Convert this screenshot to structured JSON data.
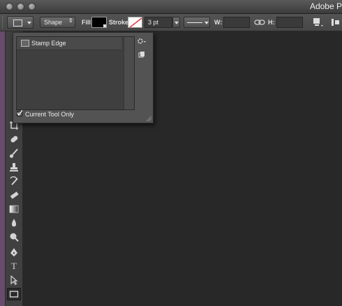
{
  "window": {
    "title": "Adobe P"
  },
  "options_bar": {
    "mode_value": "Shape",
    "fill_label": "Fill:",
    "stroke_label": "Stroke:",
    "stroke_width": "3 pt",
    "w_label": "W:",
    "h_label": "H:"
  },
  "preset_panel": {
    "items": [
      {
        "label": "Stamp Edge"
      }
    ],
    "current_tool_only_label": "Current Tool Only",
    "current_tool_only_checked": true
  },
  "tools": [
    "crop-icon",
    "eyedropper-icon",
    "healing-brush-icon",
    "brush-icon",
    "clone-stamp-icon",
    "history-brush-icon",
    "eraser-icon",
    "gradient-icon",
    "blur-icon",
    "dodge-icon",
    "pen-icon",
    "type-icon",
    "path-selection-icon",
    "rectangle-shape-icon"
  ],
  "colors": {
    "canvas": "#282828",
    "panel": "#535353",
    "optbar": "#4c4c4c",
    "accent_red": "#e23b3b"
  }
}
